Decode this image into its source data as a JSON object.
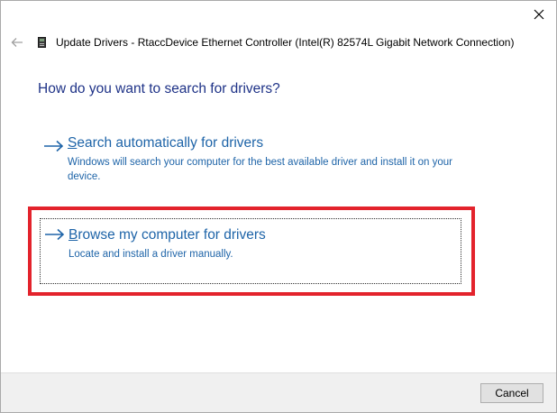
{
  "window": {
    "title": "Update Drivers - RtaccDevice Ethernet Controller (Intel(R) 82574L Gigabit Network Connection)",
    "close_icon": "close-icon",
    "back_icon": "back-arrow-icon",
    "device_icon": "device-icon"
  },
  "main": {
    "heading": "How do you want to search for drivers?",
    "options": [
      {
        "title": "Search automatically for drivers",
        "title_first_letter": "S",
        "title_rest": "earch automatically for drivers",
        "description": "Windows will search your computer for the best available driver and install it on your device.",
        "icon": "right-arrow-icon"
      },
      {
        "title": "Browse my computer for drivers",
        "title_first_letter": "B",
        "title_rest": "rowse my computer for drivers",
        "description": "Locate and install a driver manually.",
        "icon": "right-arrow-icon",
        "focused": true,
        "highlighted": true
      }
    ]
  },
  "footer": {
    "cancel_label": "Cancel"
  },
  "colors": {
    "heading": "#1e3287",
    "link": "#1e64a8",
    "highlight": "#e3232c",
    "footer_bg": "#f0f0f0"
  }
}
